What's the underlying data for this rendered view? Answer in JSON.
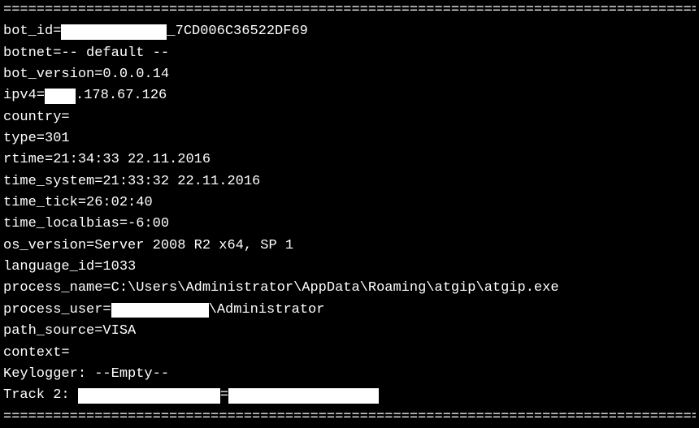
{
  "divider": "================================================================================================",
  "fields": {
    "bot_id_key": "bot_id=",
    "bot_id_suffix": "_7CD006C36522DF69",
    "botnet_key": "botnet=",
    "botnet_val": "-- default --",
    "bot_version_key": "bot_version=",
    "bot_version_val": "0.0.0.14",
    "ipv4_key": "ipv4=",
    "ipv4_suffix": ".178.67.126",
    "country_key": "country=",
    "country_val": "",
    "type_key": "type=",
    "type_val": "301",
    "rtime_key": "rtime=",
    "rtime_val": "21:34:33 22.11.2016",
    "time_system_key": "time_system=",
    "time_system_val": "21:33:32 22.11.2016",
    "time_tick_key": "time_tick=",
    "time_tick_val": "26:02:40",
    "time_localbias_key": "time_localbias=",
    "time_localbias_val": "-6:00",
    "os_version_key": "os_version=",
    "os_version_val": "Server 2008 R2 x64, SP 1",
    "language_id_key": "language_id=",
    "language_id_val": "1033",
    "process_name_key": "process_name=",
    "process_name_val": "C:\\Users\\Administrator\\AppData\\Roaming\\atgip\\atgip.exe",
    "process_user_key": "process_user=",
    "process_user_suffix": "\\Administrator",
    "path_source_key": "path_source=",
    "path_source_val": "VISA",
    "context_key": "context=",
    "context_val": "",
    "keylogger_key": "Keylogger: ",
    "keylogger_val": "--Empty--",
    "track2_key": "Track 2: ",
    "track2_mid": "="
  }
}
